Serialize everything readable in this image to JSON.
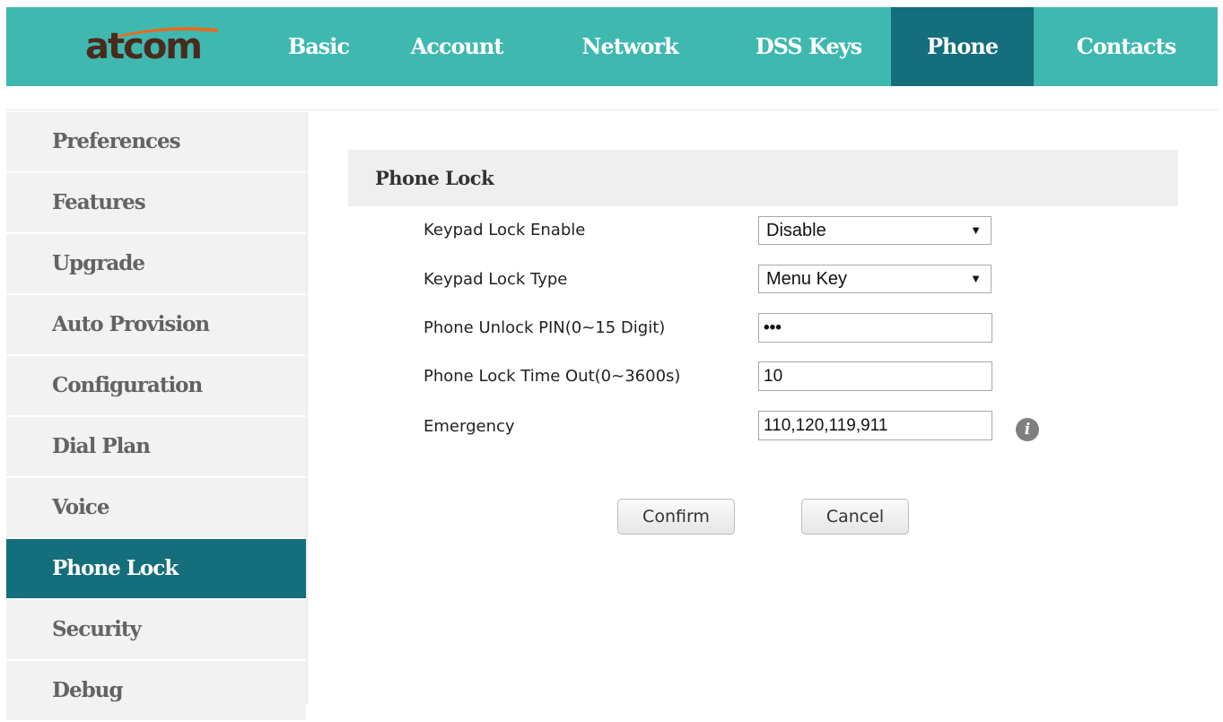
{
  "brand": {
    "logo_text": "atcom",
    "primary_color": "#3fb8b0",
    "active_color": "#146e7b"
  },
  "nav": {
    "tabs": [
      {
        "label": "Basic",
        "active": false
      },
      {
        "label": "Account",
        "active": false
      },
      {
        "label": "Network",
        "active": false
      },
      {
        "label": "DSS Keys",
        "active": false
      },
      {
        "label": "Phone",
        "active": true
      },
      {
        "label": "Contacts",
        "active": false
      }
    ]
  },
  "sidebar": {
    "items": [
      {
        "label": "Preferences",
        "active": false
      },
      {
        "label": "Features",
        "active": false
      },
      {
        "label": "Upgrade",
        "active": false
      },
      {
        "label": "Auto Provision",
        "active": false
      },
      {
        "label": "Configuration",
        "active": false
      },
      {
        "label": "Dial Plan",
        "active": false
      },
      {
        "label": "Voice",
        "active": false
      },
      {
        "label": "Phone Lock",
        "active": true
      },
      {
        "label": "Security",
        "active": false
      },
      {
        "label": "Debug",
        "active": false
      }
    ]
  },
  "section": {
    "title": "Phone Lock"
  },
  "form": {
    "keypad_lock_enable": {
      "label": "Keypad Lock Enable",
      "value": "Disable"
    },
    "keypad_lock_type": {
      "label": "Keypad Lock Type",
      "value": "Menu Key"
    },
    "unlock_pin": {
      "label": "Phone Unlock PIN(0~15 Digit)",
      "value": "•••"
    },
    "lock_timeout": {
      "label": "Phone Lock Time Out(0~3600s)",
      "value": "10"
    },
    "emergency": {
      "label": "Emergency",
      "value": "110,120,119,911",
      "info_icon": "info-icon"
    }
  },
  "buttons": {
    "confirm": "Confirm",
    "cancel": "Cancel"
  },
  "icons": {
    "dropdown": "▼",
    "info": "i"
  }
}
